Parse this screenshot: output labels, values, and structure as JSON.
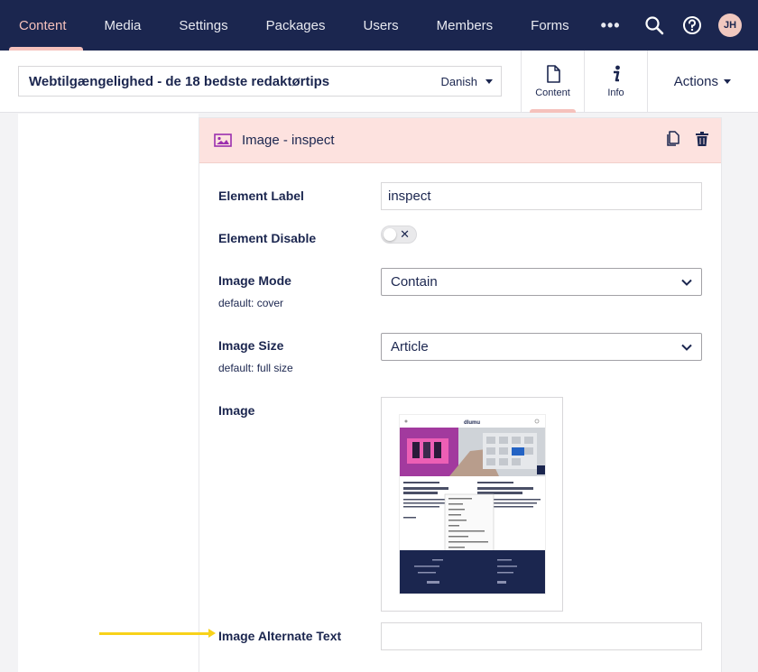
{
  "nav": {
    "items": [
      {
        "label": "Content",
        "active": true
      },
      {
        "label": "Media"
      },
      {
        "label": "Settings"
      },
      {
        "label": "Packages"
      },
      {
        "label": "Users"
      },
      {
        "label": "Members"
      },
      {
        "label": "Forms"
      }
    ],
    "more": "•••",
    "avatar_initials": "JH"
  },
  "header": {
    "node_name": "Webtilgængelighed - de 18 bedste redaktørtips",
    "language": "Danish",
    "apps": [
      {
        "label": "Content",
        "icon": "document-icon",
        "active": true
      },
      {
        "label": "Info",
        "icon": "info-icon"
      }
    ],
    "actions_label": "Actions"
  },
  "element": {
    "title": "Image - inspect",
    "icon": "picture-icon",
    "fields": {
      "label": {
        "label": "Element Label",
        "value": "inspect"
      },
      "disable": {
        "label": "Element Disable",
        "value": false
      },
      "mode": {
        "label": "Image Mode",
        "description": "default: cover",
        "value": "Contain"
      },
      "size": {
        "label": "Image Size",
        "description": "default: full size",
        "value": "Article"
      },
      "image": {
        "label": "Image",
        "thumb_logo": "dlumu"
      },
      "alt": {
        "label": "Image Alternate Text",
        "value": ""
      }
    }
  },
  "colors": {
    "nav_bg": "#1b264f",
    "accent": "#f5c1bc",
    "panel_header": "#fde2df",
    "annotation_arrow": "#f8d21a"
  }
}
